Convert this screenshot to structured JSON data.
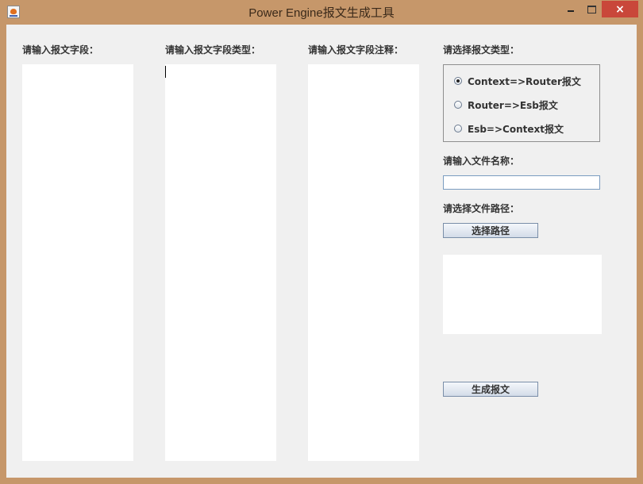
{
  "window": {
    "title": "Power Engine报文生成工具",
    "close_glyph": "×",
    "maximize_glyph": "□",
    "minimize_glyph": "—"
  },
  "fields": {
    "field_label": "请输入报文字段：",
    "field_type_label": "请输入报文字段类型：",
    "field_comment_label": "请输入报文字段注释：",
    "field_value": "",
    "field_type_value": "",
    "field_comment_value": ""
  },
  "message_type": {
    "label": "请选择报文类型：",
    "options": [
      {
        "label": "Context=>Router报文",
        "checked": true
      },
      {
        "label": "Router=>Esb报文",
        "checked": false
      },
      {
        "label": "Esb=>Context报文",
        "checked": false
      }
    ]
  },
  "file_name": {
    "label": "请输入文件名称：",
    "value": ""
  },
  "file_path": {
    "label": "请选择文件路径：",
    "button_label": "选择路径",
    "value": ""
  },
  "generate": {
    "button_label": "生成报文"
  },
  "colors": {
    "titlebar": "#c6976a",
    "close_button": "#c9473a",
    "client_bg": "#f0f0f0"
  }
}
